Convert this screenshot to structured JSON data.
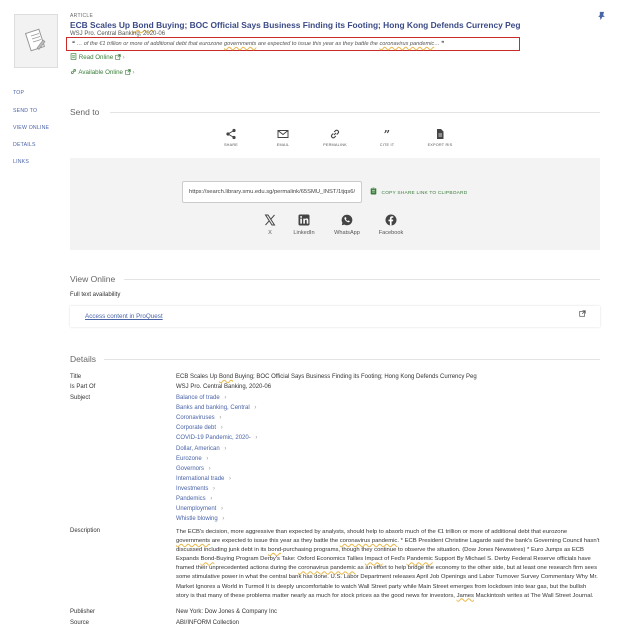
{
  "record": {
    "type_label": "ARTICLE",
    "title_parts": [
      "ECB Scales Up ",
      "Bond",
      " Buying; BOC Official Says Business Finding its Footing; Hong Kong Defends Currency Peg"
    ],
    "source": "WSJ Pro. Central Banking, 2020-06",
    "snippet_parts": [
      "… of the €1 trillion or more of additional debt that eurozone ",
      "governments",
      " are expected to issue this year as they battle the ",
      "coronavirus pandemic",
      "…"
    ],
    "open_quote": "❝",
    "close_quote": "❞",
    "read_online": "Read Online",
    "available_online": "Available Online"
  },
  "side_nav": [
    "TOP",
    "SEND TO",
    "VIEW ONLINE",
    "DETAILS",
    "LINKS"
  ],
  "send_to": {
    "heading": "Send to",
    "actions": [
      {
        "label": "SHARE",
        "icon": "share-icon"
      },
      {
        "label": "EMAIL",
        "icon": "email-icon"
      },
      {
        "label": "PERMALINK",
        "icon": "link-icon"
      },
      {
        "label": "CITE IT",
        "icon": "quote-icon"
      },
      {
        "label": "EXPORT RIS",
        "icon": "file-icon"
      }
    ],
    "permalink_value": "https://search.library.smu.edu.sg/permalink/65SMU_INST/1tjqs6/cdi_proquest",
    "copy_label": "COPY SHARE LINK TO CLIPBOARD",
    "social": [
      {
        "label": "X",
        "icon": "x-icon"
      },
      {
        "label": "LinkedIn",
        "icon": "linkedin-icon"
      },
      {
        "label": "WhatsApp",
        "icon": "whatsapp-icon"
      },
      {
        "label": "Facebook",
        "icon": "facebook-icon"
      }
    ]
  },
  "view_online": {
    "heading": "View Online",
    "full_text_label": "Full text availability",
    "link_text": "Access content in ProQuest"
  },
  "details": {
    "heading": "Details",
    "labels": {
      "title": "Title",
      "is_part_of": "Is Part Of",
      "subject": "Subject",
      "description": "Description",
      "publisher": "Publisher",
      "source": "Source"
    },
    "title_parts": [
      "ECB Scales Up ",
      "Bond",
      " Buying; BOC Official Says Business Finding its Footing; Hong Kong Defends Currency Peg"
    ],
    "is_part_of": "WSJ Pro. Central Banking, 2020-06",
    "subjects": [
      "Balance of trade",
      "Banks and banking, Central",
      "Coronaviruses",
      "Corporate debt",
      "COVID-19 Pandemic, 2020-",
      "Dollar, American",
      "Eurozone",
      "Governors",
      "International trade",
      "Investments",
      "Pandemics",
      "Unemployment",
      "Whistle blowing"
    ],
    "description_parts": [
      "The ECB's decision, more aggressive than expected by analysts, should help to absorb much of the €1 trillion or more of additional debt that eurozone ",
      "governments",
      " are expected to issue this year as they battle the ",
      "coronavirus pandemic",
      ". * ECB President Christine Lagarde said the bank's Governing Council hasn't discussed including junk debt in its ",
      "bond",
      "-purchasing programs, though they continue to observe the situation. (Dow Jones Newswires) * Euro Jumps as ECB Expands ",
      "Bond",
      "-Buying Program Derby's Take: Oxford Economics Tallies ",
      "Impact",
      " of Fed's ",
      "Pandemic",
      " Support By Michael S. Derby Federal Reserve officials have framed their unprecedented actions during the ",
      "coronavirus pandemic",
      " as an effort to help bridge the economy to the other side, but at least one research firm sees some stimulative power in what the central bank has done. U.S. Labor Department releases April Job Openings and Labor Turnover Survey Commentary Why Mr. Market Ignores a World in Turmoil It is deeply uncomfortable to watch Wall Street party while Main Street emerges from lockdown into tear gas, but the bullish story is that many of these problems matter nearly as much for stock prices as the good news for investors, ",
      "James",
      " Mackintosh writes at The Wall Street Journal."
    ],
    "publisher": "New York: Dow Jones & Company Inc",
    "source": "ABI/INFORM Collection"
  },
  "colors": {
    "title_blue": "#3b4a86",
    "link_blue": "#4a64a8",
    "green": "#3a7d3a",
    "highlight_box": "#c92a2a",
    "pin": "#4a64a8"
  }
}
